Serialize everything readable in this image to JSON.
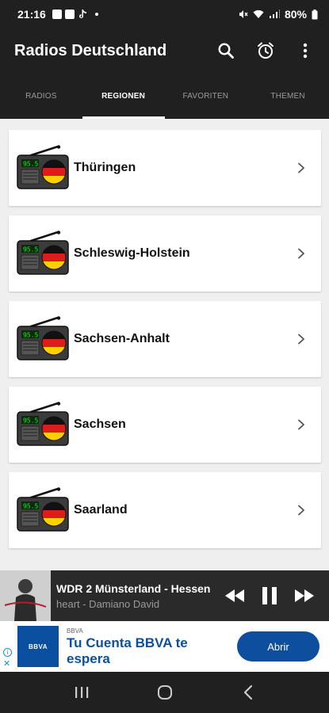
{
  "status_bar": {
    "time": "21:16",
    "battery_text": "80%"
  },
  "toolbar": {
    "title": "Radios Deutschland",
    "search_icon": "search-icon",
    "alarm_icon": "alarm-icon",
    "more_icon": "more-vert-icon"
  },
  "tabs": [
    {
      "label": "RADIOS",
      "active": false
    },
    {
      "label": "REGIONEN",
      "active": true
    },
    {
      "label": "FAVORITEN",
      "active": false
    },
    {
      "label": "THEMEN",
      "active": false
    }
  ],
  "regions": [
    {
      "label": "Thüringen",
      "icon": "radio-germany-flag-icon",
      "badge": "95.5"
    },
    {
      "label": "Schleswig-Holstein",
      "icon": "radio-germany-flag-icon",
      "badge": "95.5"
    },
    {
      "label": "Sachsen-Anhalt",
      "icon": "radio-germany-flag-icon",
      "badge": "95.5"
    },
    {
      "label": "Sachsen",
      "icon": "radio-germany-flag-icon",
      "badge": "95.5"
    },
    {
      "label": "Saarland",
      "icon": "radio-germany-flag-icon",
      "badge": "95.5"
    }
  ],
  "player": {
    "station": "WDR 2 Münsterland - Hessen",
    "track": "heart - Damiano David"
  },
  "ad": {
    "logo_text": "BBVA",
    "brand": "BBVA",
    "headline_line1": "Tu Cuenta BBVA te",
    "headline_line2": "espera",
    "cta": "Abrir"
  },
  "colors": {
    "bar_bg": "#202020",
    "list_bg": "#efefef",
    "ad_blue": "#0d4f9e"
  }
}
